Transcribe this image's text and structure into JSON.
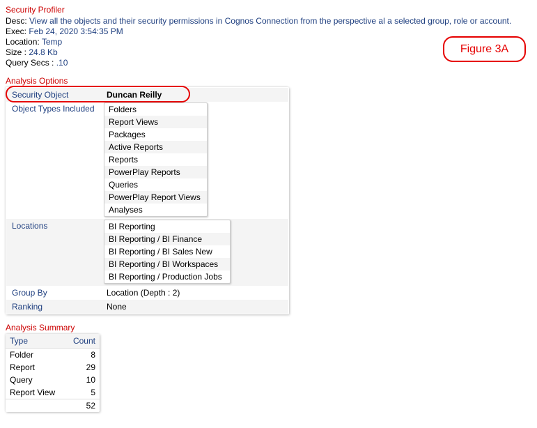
{
  "header": {
    "title": "Security Profiler",
    "desc_label": "Desc:",
    "desc_value": "View all the objects and their security permissions in Cognos Connection from the perspective al a selected group, role or account.",
    "exec_label": "Exec:",
    "exec_value": "Feb 24, 2020 3:54:35 PM",
    "location_label": "Location:",
    "location_value": "Temp",
    "size_label": "Size :",
    "size_value": "24.8 Kb",
    "query_secs_label": "Query Secs :",
    "query_secs_value": ".10"
  },
  "figure_label": "Figure 3A",
  "options": {
    "title": "Analysis Options",
    "rows": {
      "security_object": {
        "label": "Security Object",
        "value": "Duncan Reilly"
      },
      "object_types": {
        "label": "Object Types Included",
        "items": [
          "Folders",
          "Report Views",
          "Packages",
          "Active Reports",
          "Reports",
          "PowerPlay Reports",
          "Queries",
          "PowerPlay Report Views",
          "Analyses"
        ]
      },
      "locations": {
        "label": "Locations",
        "items": [
          "BI Reporting",
          "BI Reporting / BI Finance",
          "BI Reporting / BI Sales New",
          "BI Reporting / BI Workspaces",
          "BI Reporting / Production Jobs"
        ]
      },
      "group_by": {
        "label": "Group By",
        "value": "Location (Depth : 2)"
      },
      "ranking": {
        "label": "Ranking",
        "value": "None"
      }
    }
  },
  "summary": {
    "title": "Analysis Summary",
    "col_type": "Type",
    "col_count": "Count",
    "rows": [
      {
        "type": "Folder",
        "count": "8"
      },
      {
        "type": "Report",
        "count": "29"
      },
      {
        "type": "Query",
        "count": "10"
      },
      {
        "type": "Report View",
        "count": "5"
      }
    ],
    "total": "52"
  }
}
